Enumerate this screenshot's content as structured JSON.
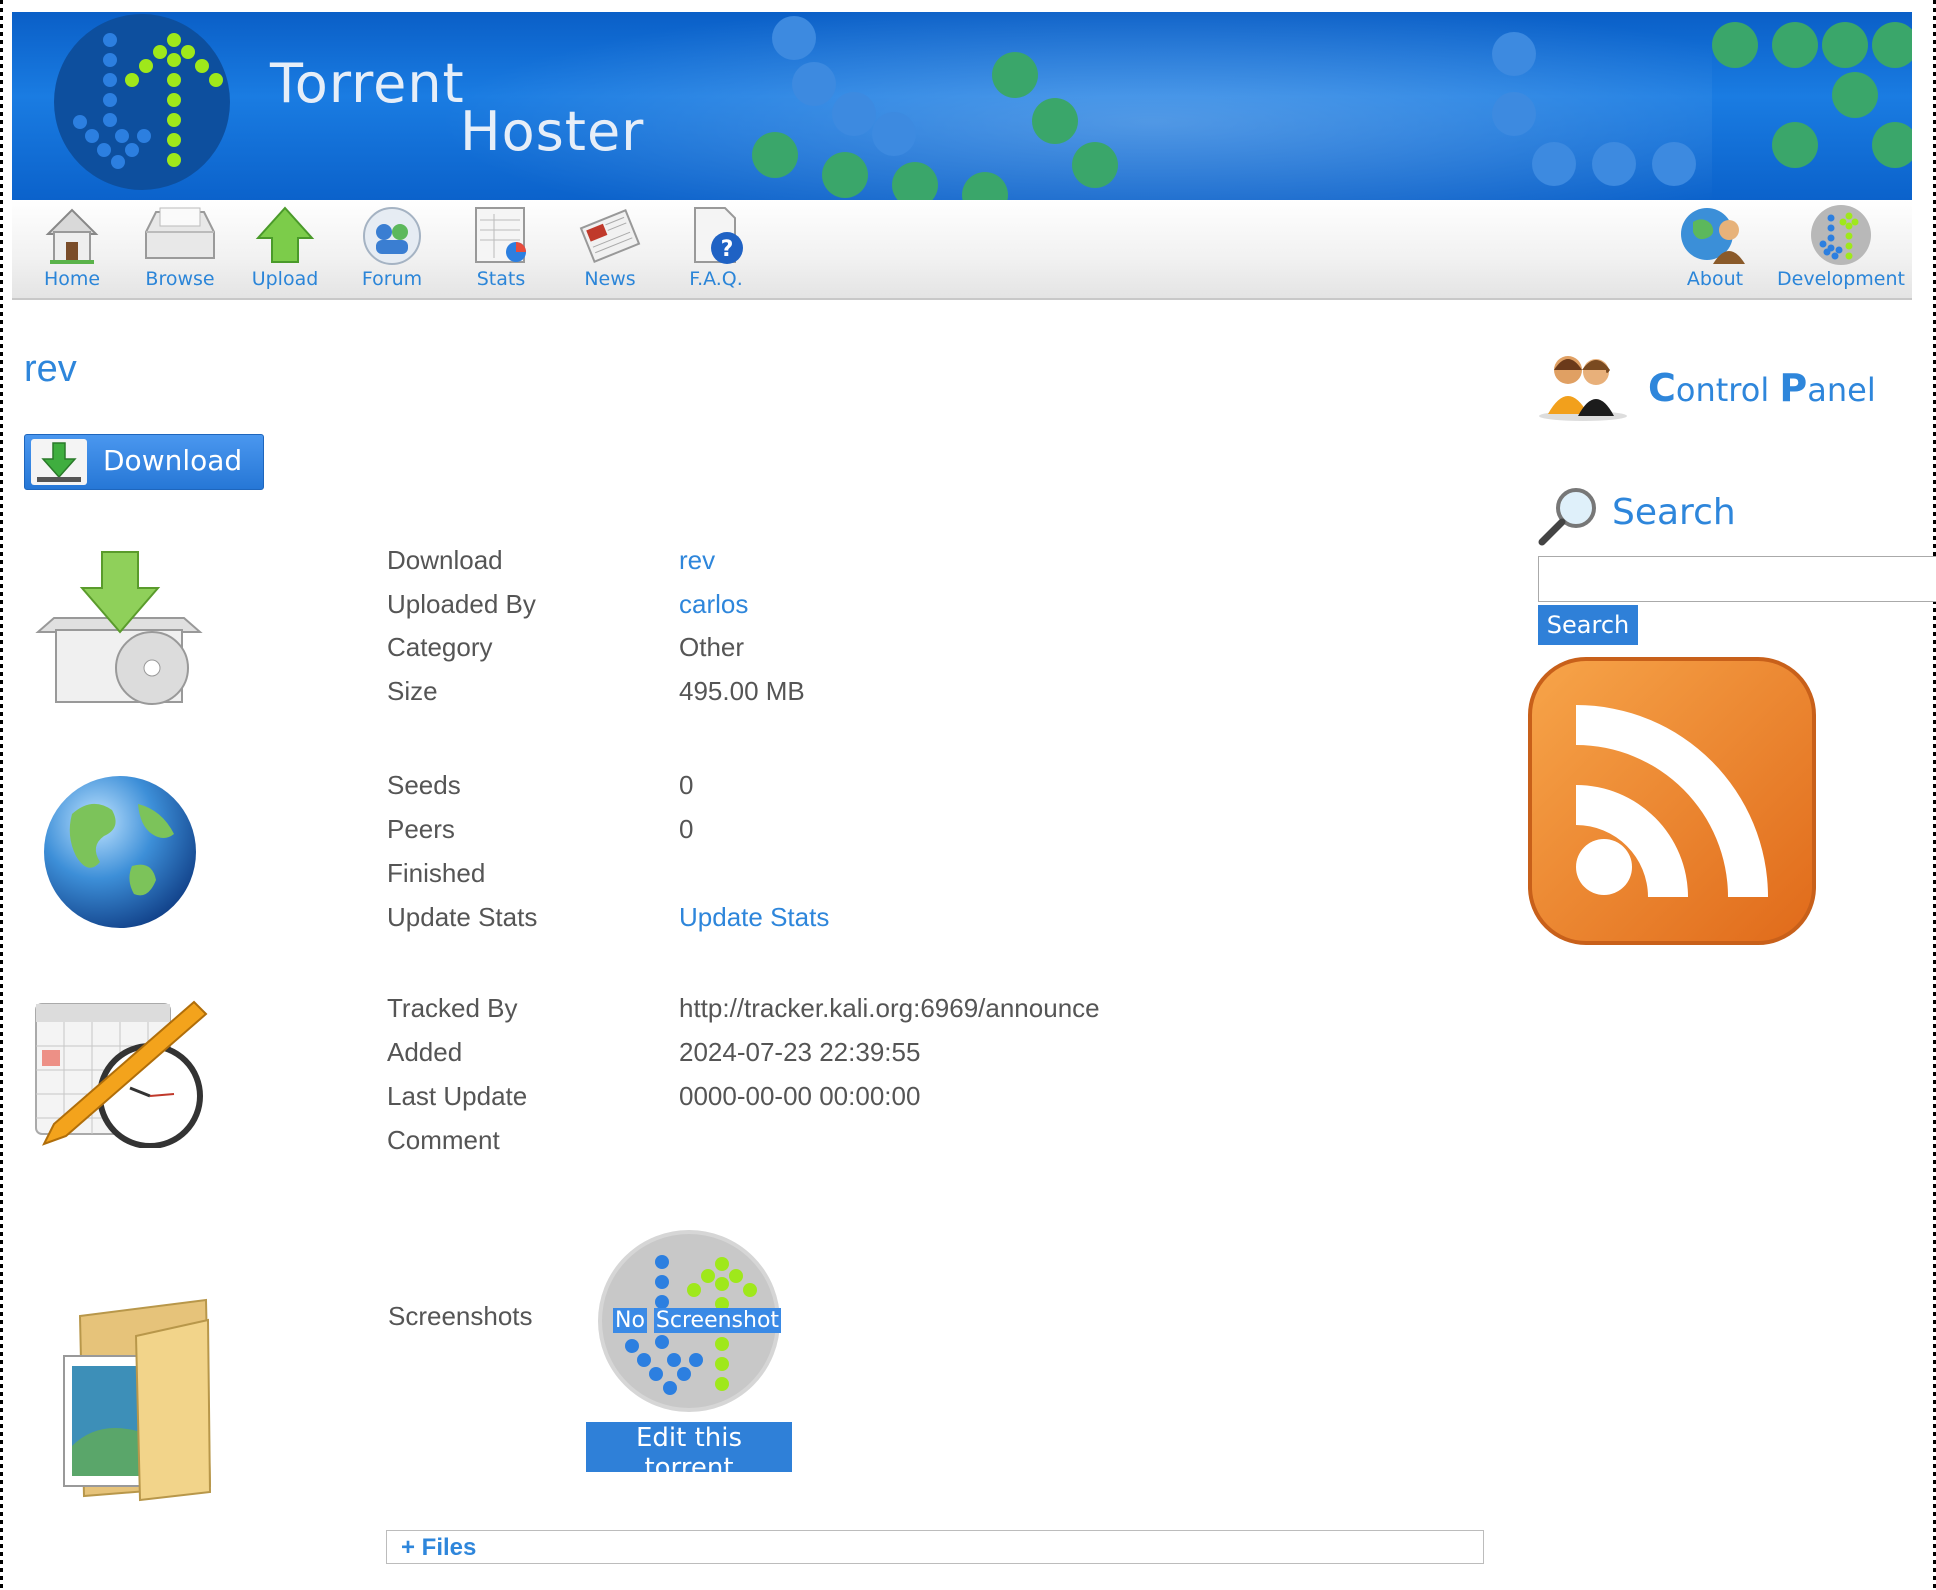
{
  "banner": {
    "title_line1": "Torrent",
    "title_line2": "Hoster"
  },
  "nav": {
    "items": [
      {
        "label": "Home",
        "icon": "home-icon"
      },
      {
        "label": "Browse",
        "icon": "browse-icon"
      },
      {
        "label": "Upload",
        "icon": "upload-icon"
      },
      {
        "label": "Forum",
        "icon": "forum-icon"
      },
      {
        "label": "Stats",
        "icon": "stats-icon"
      },
      {
        "label": "News",
        "icon": "news-icon"
      },
      {
        "label": "F.A.Q.",
        "icon": "faq-icon"
      },
      {
        "label": "About",
        "icon": "about-icon"
      },
      {
        "label": "Development",
        "icon": "development-icon"
      }
    ]
  },
  "torrent": {
    "title": "rev",
    "download_button": "Download",
    "details": [
      {
        "label": "Download",
        "value": "rev"
      },
      {
        "label": "Uploaded By",
        "value": "carlos"
      },
      {
        "label": "Category",
        "value": "Other"
      },
      {
        "label": "Size",
        "value": "495.00 MB"
      }
    ],
    "stats": [
      {
        "label": "Seeds",
        "value": "0"
      },
      {
        "label": "Peers",
        "value": "0"
      },
      {
        "label": "Finished",
        "value": ""
      },
      {
        "label": "Update Stats",
        "value": "Update Stats"
      }
    ],
    "tracking": [
      {
        "label": "Tracked By",
        "value": "http://tracker.kali.org:6969/announce"
      },
      {
        "label": "Added",
        "value": "2024-07-23 22:39:55"
      },
      {
        "label": "Last Update",
        "value": "0000-00-00 00:00:00"
      },
      {
        "label": "Comment",
        "value": ""
      }
    ],
    "screenshots_label": "Screenshots",
    "no_screenshot_word1": "No",
    "no_screenshot_word2": "Screenshot",
    "edit_button": "Edit this torrent",
    "files_toggle": "+ Files"
  },
  "sidebar": {
    "control_panel_c": "C",
    "control_panel_rest1": "ontrol ",
    "control_panel_p": "P",
    "control_panel_rest2": "anel",
    "search_title": "Search",
    "search_input_value": "",
    "search_button": "Search"
  },
  "colors": {
    "accent": "#2e86db",
    "banner": "#1a7ce2",
    "rss": "#f08a24"
  }
}
